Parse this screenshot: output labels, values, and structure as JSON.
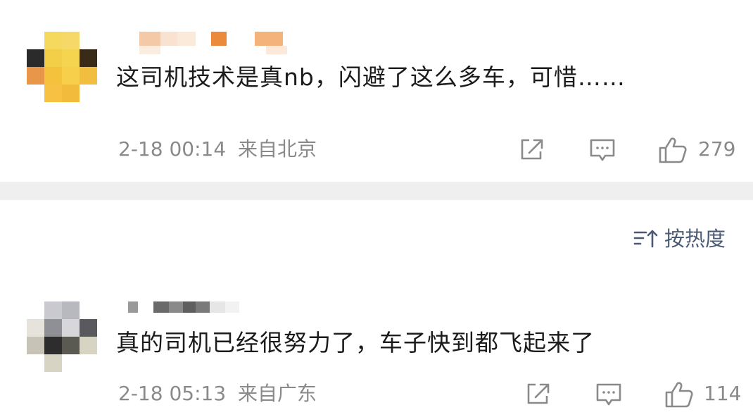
{
  "comments": [
    {
      "text": "这司机技术是真nb，闪避了这么多车，可惜……",
      "time": "2-18 00:14",
      "location": "来自北京",
      "likes": "279",
      "share_icon": "share-icon",
      "reply_icon": "comment-icon",
      "like_icon": "thumbs-up-icon"
    },
    {
      "text": "真的司机已经很努力了，车子快到都飞起来了",
      "time": "2-18 05:13",
      "location": "来自广东",
      "likes": "114",
      "share_icon": "share-icon",
      "reply_icon": "comment-icon",
      "like_icon": "thumbs-up-icon"
    }
  ],
  "sort": {
    "label": "按热度",
    "icon": "sort-icon"
  },
  "colors": {
    "meta_gray": "#8a8a8a",
    "sort_blue": "#4a5a73",
    "divider": "#efefef"
  }
}
